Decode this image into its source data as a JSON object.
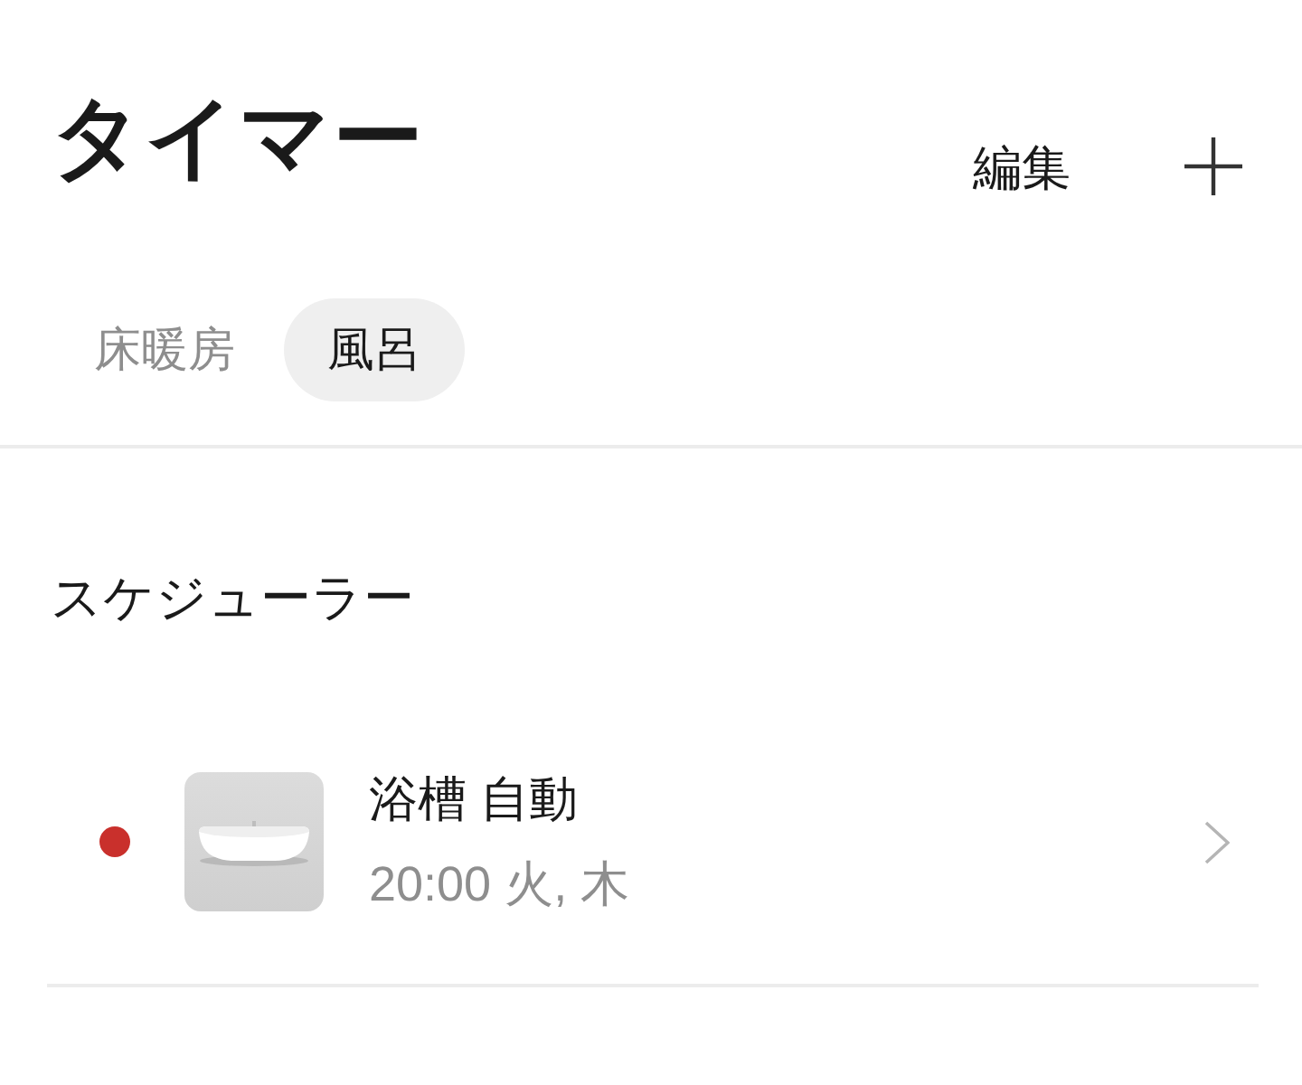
{
  "header": {
    "title": "タイマー",
    "edit_label": "編集"
  },
  "tabs": [
    {
      "label": "床暖房",
      "selected": false
    },
    {
      "label": "風呂",
      "selected": true
    }
  ],
  "section": {
    "title": "スケジューラー",
    "items": [
      {
        "title": "浴槽 自動",
        "schedule": "20:00 火, 木",
        "color": "#c9302c"
      }
    ]
  }
}
